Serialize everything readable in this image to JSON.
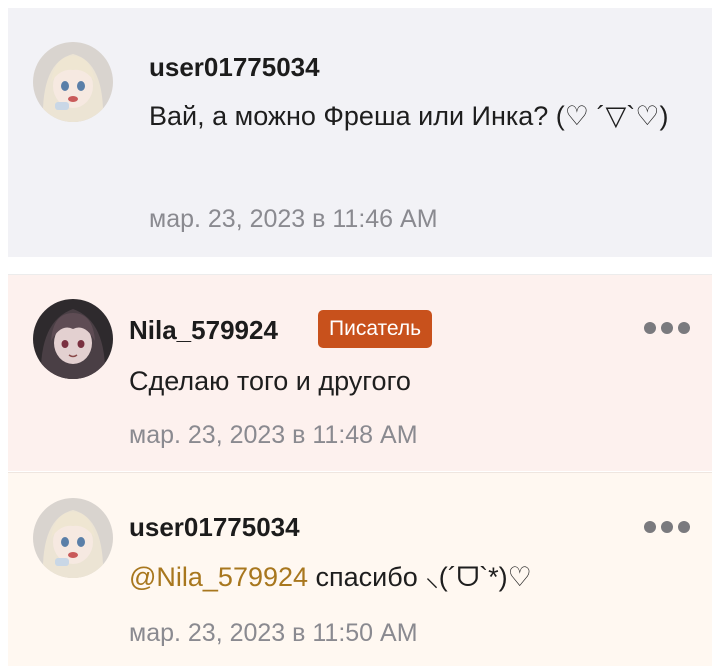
{
  "comments": [
    {
      "username": "user01775034",
      "text": "Вай, а можно Фреша или Инка? (♡ ´▽`♡)",
      "timestamp": "мар. 23, 2023 в 11:46 AM",
      "avatar_icon": "anime-girl-avatar-icon"
    },
    {
      "username": "Nila_579924",
      "badge": "Писатель",
      "text": "Сделаю того и другого",
      "timestamp": "мар. 23, 2023 в 11:48 AM",
      "avatar_icon": "dark-anime-avatar-icon",
      "more_icon": "more-options-icon"
    },
    {
      "username": "user01775034",
      "mention": "@Nila_579924",
      "text": " спасибо ⸜(´ᗜ`*)♡",
      "timestamp": "мар. 23, 2023 в 11:50 AM",
      "avatar_icon": "anime-girl-avatar-icon",
      "more_icon": "more-options-icon"
    }
  ],
  "colors": {
    "badge": "#c8511c",
    "mention": "#a8771e",
    "timestamp": "#8a8a90"
  }
}
